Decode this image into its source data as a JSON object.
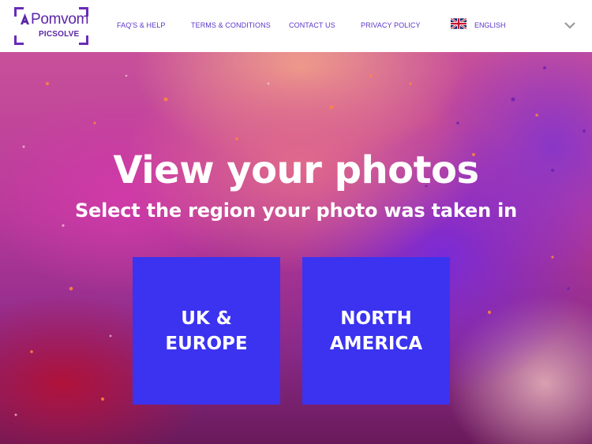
{
  "header": {
    "brand_name": "Pomvom",
    "brand_sub": "PICSOLVE",
    "nav": [
      {
        "label": "FAQ'S & HELP"
      },
      {
        "label": "TERMS & CONDITIONS"
      },
      {
        "label": "CONTACT US"
      },
      {
        "label": "PRIVACY POLICY"
      }
    ],
    "language": {
      "label": "ENGLISH",
      "flag_icon": "uk-flag-icon",
      "chevron_icon": "chevron-down-icon"
    }
  },
  "hero": {
    "title": "View your photos",
    "subtitle": "Select the region your photo was taken in",
    "regions": [
      {
        "label": "UK &\nEUROPE"
      },
      {
        "label": "NORTH\nAMERICA"
      }
    ]
  },
  "colors": {
    "brand_purple": "#5b25a8",
    "nav_text": "#5b35c9",
    "region_button": "#3b33f0"
  }
}
